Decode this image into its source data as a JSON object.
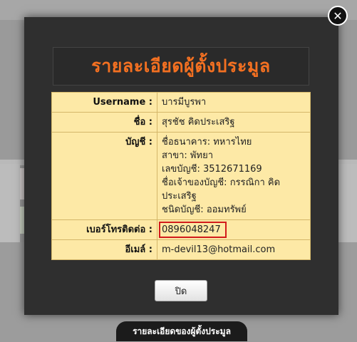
{
  "modal": {
    "title": "รายละเอียดผู้ตั้งประมูล",
    "close_icon_glyph": "✕",
    "close_button_label": "ปิด",
    "rows": {
      "username": {
        "label": "Username :",
        "value": "บารมีบูรพา"
      },
      "name": {
        "label": "ชื่อ :",
        "value": "สุรชัช คิดประเสริฐ"
      },
      "account": {
        "label": "บัญชี :",
        "lines": [
          "ชื่อธนาคาร: ทหารไทย",
          "สาขา: พัทยา",
          "เลขบัญชี: 3512671169",
          "ชื่อเจ้าของบัญชี: กรรณิกา คิด ประเสริฐ",
          "ชนิดบัญชี: ออมทรัพย์"
        ]
      },
      "phone": {
        "label": "เบอร์โทรติดต่อ :",
        "value": "0896048247"
      },
      "email": {
        "label": "อีเมล์ :",
        "value": "m-devil13@hotmail.com"
      }
    }
  },
  "bottom_bar": {
    "label": "รายละเอียดของผู้ตั้งประมูล"
  },
  "colors": {
    "title": "#f37021",
    "table_bg": "#fde9a6",
    "highlight_border": "#d21b1b",
    "modal_bg": "#2f2f2f"
  }
}
